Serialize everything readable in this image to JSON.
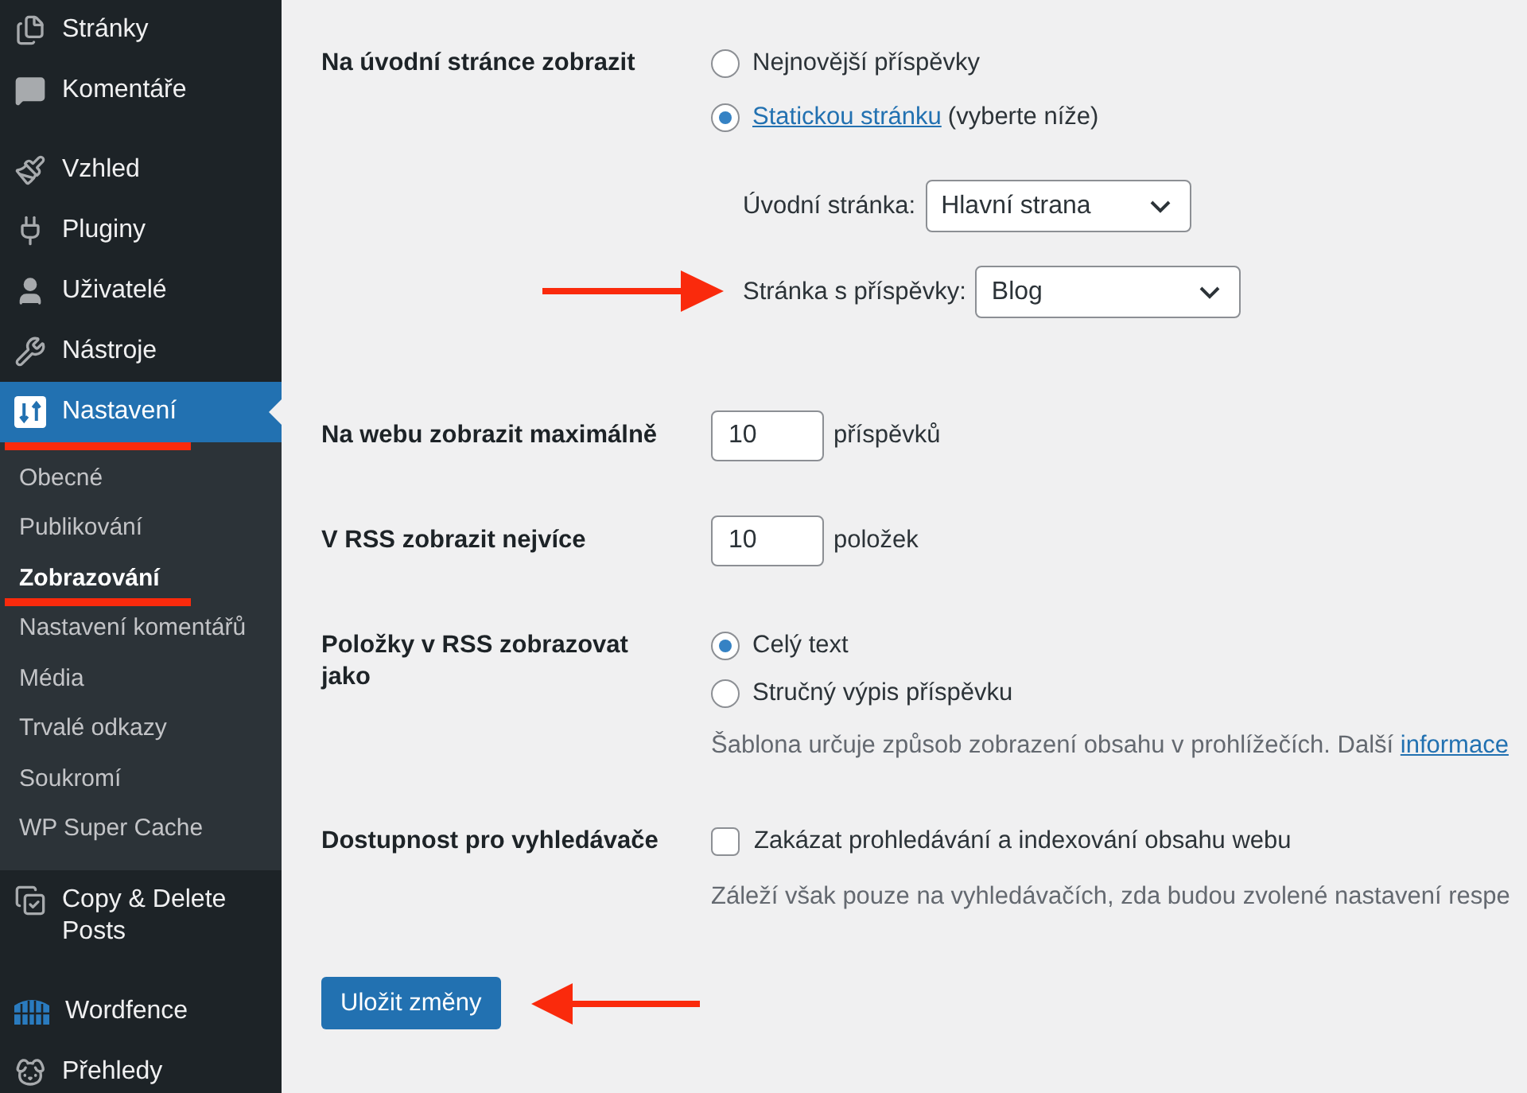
{
  "sidebar": {
    "groups": [
      [
        {
          "label": "Stránky",
          "selected": false,
          "underlined": false
        },
        {
          "label": "Komentáře",
          "selected": false,
          "underlined": false
        }
      ],
      [
        {
          "label": "Vzhled",
          "selected": false,
          "underlined": false
        },
        {
          "label": "Pluginy",
          "selected": false,
          "underlined": false
        },
        {
          "label": "Uživatelé",
          "selected": false,
          "underlined": false
        },
        {
          "label": "Nástroje",
          "selected": false,
          "underlined": false
        },
        {
          "label": "Nastavení",
          "selected": true,
          "underlined": true,
          "children": [
            {
              "label": "Obecné",
              "selected": false,
              "underlined": false
            },
            {
              "label": "Publikování",
              "selected": false,
              "underlined": false
            },
            {
              "label": "Zobrazování",
              "selected": true,
              "underlined": true
            },
            {
              "label": "Nastavení komentářů",
              "selected": false,
              "underlined": false
            },
            {
              "label": "Média",
              "selected": false,
              "underlined": false
            },
            {
              "label": "Trvalé odkazy",
              "selected": false,
              "underlined": false
            },
            {
              "label": "Soukromí",
              "selected": false,
              "underlined": false
            },
            {
              "label": "WP Super Cache",
              "selected": false,
              "underlined": false
            }
          ]
        },
        {
          "label": "Copy & Delete Posts",
          "selected": false,
          "underlined": false
        }
      ],
      [
        {
          "label": "Wordfence",
          "selected": false,
          "underlined": false
        },
        {
          "label": "Přehledy",
          "selected": false,
          "underlined": false
        }
      ]
    ]
  },
  "settings": {
    "rows": [
      {
        "kind": "front_page",
        "label": "Na úvodní stránce zobrazit",
        "options": [
          {
            "label": "Nejnovější příspěvky",
            "selected": false
          },
          {
            "link": "Statickou stránku",
            "label": "(vyberte níže)",
            "selected": true
          }
        ],
        "selects": [
          {
            "label": "Úvodní stránka:",
            "value": "Hlavní strana",
            "pointed_at": false
          },
          {
            "label": "Stránka s příspěvky:",
            "value": "Blog",
            "pointed_at": true
          }
        ]
      },
      {
        "kind": "number",
        "label": "Na webu zobrazit maximálně",
        "value": "10",
        "suffix": "příspěvků"
      },
      {
        "kind": "number",
        "label": "V RSS zobrazit nejvíce",
        "value": "10",
        "suffix": "položek"
      },
      {
        "kind": "radio",
        "label": "Položky v RSS zobrazovat jako",
        "options": [
          {
            "label": "Celý text",
            "selected": true
          },
          {
            "label": "Stručný výpis příspěvku",
            "selected": false
          }
        ],
        "description": "Šablona určuje způsob zobrazení obsahu v prohlížečích. Další",
        "description_link": "informace"
      },
      {
        "kind": "checkbox",
        "label": "Dostupnost pro vyhledávače",
        "checkbox": {
          "label": "Zakázat prohledávání a indexování obsahu webu",
          "checked": false
        },
        "description": "Záleží však pouze na vyhledávačích, zda budou zvolené nastavení respe"
      }
    ]
  },
  "save_button": {
    "label": "Uložit změny",
    "pointed_at": true
  }
}
